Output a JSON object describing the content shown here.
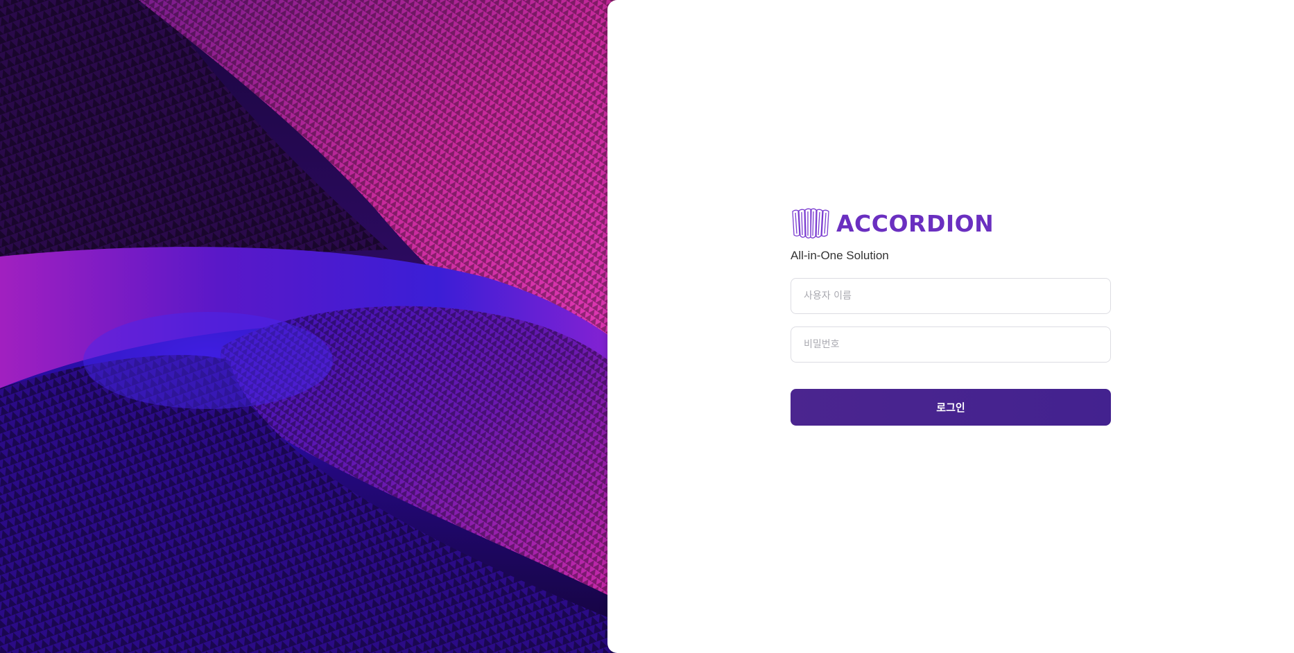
{
  "brand": {
    "name": "ACCORDION",
    "tagline": "All-in-One Solution",
    "logo_icon": "accordion-icon",
    "color": "#6a2fc0"
  },
  "form": {
    "username_placeholder": "사용자 이름",
    "password_placeholder": "비밀번호",
    "submit_label": "로그인",
    "button_color": "#4b258f"
  },
  "hero": {
    "image": "abstract-purple-magenta-wave-pattern",
    "colors": [
      "#2a0fb0",
      "#c0268f",
      "#1b0640"
    ]
  }
}
